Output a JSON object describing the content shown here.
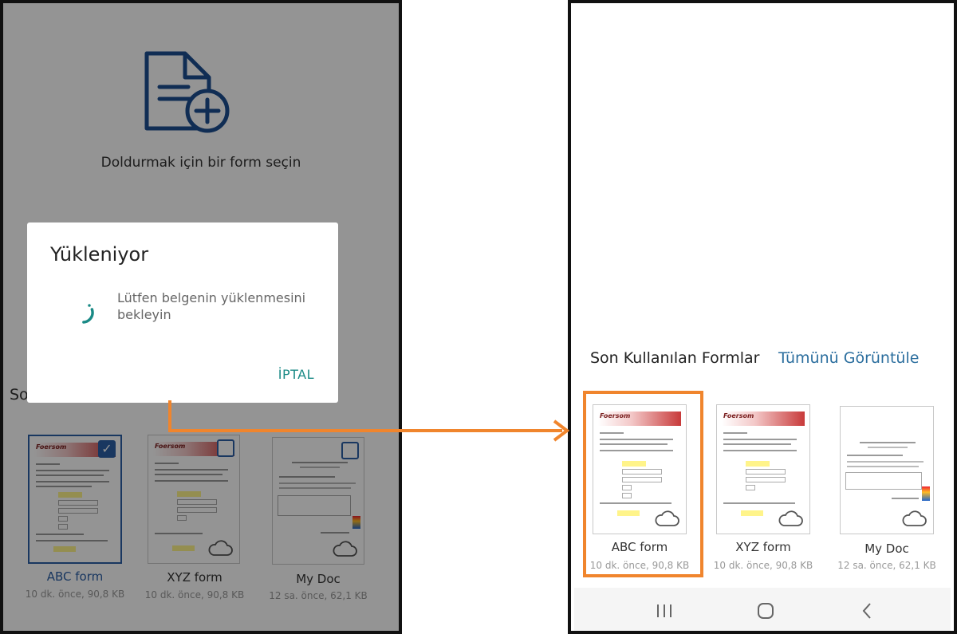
{
  "left_screen": {
    "prompt_text": "Doldurmak için bir form seçin",
    "recent_partial": "So",
    "dialog": {
      "title": "Yükleniyor",
      "message": "Lütfen belgenin yüklenmesini bekleyin",
      "cancel_label": "İPTAL"
    },
    "forms": [
      {
        "name": "ABC form",
        "meta": "10 dk. önce, 90,8 KB",
        "checked": true,
        "logo": "Foersom"
      },
      {
        "name": "XYZ form",
        "meta": "10 dk. önce, 90,8 KB",
        "checked": false,
        "logo": "Foersom"
      },
      {
        "name": "My Doc",
        "meta": "12 sa. önce, 62,1 KB",
        "checked": false
      }
    ]
  },
  "right_screen": {
    "section_title": "Son Kullanılan Formlar",
    "view_all_label": "Tümünü Görüntüle",
    "forms": [
      {
        "name": "ABC form",
        "meta": "10 dk. önce, 90,8 KB",
        "logo": "Foersom"
      },
      {
        "name": "XYZ form",
        "meta": "10 dk. önce, 90,8 KB",
        "logo": "Foersom"
      },
      {
        "name": "My Doc",
        "meta": "12 sa. önce, 62,1 KB"
      }
    ]
  },
  "icons": {
    "add_file": "file-add-icon",
    "spinner": "loading-spinner-icon",
    "cloud": "cloud-icon",
    "checkbox": "checkbox-icon",
    "nav_recents": "recents-icon",
    "nav_home": "home-icon",
    "nav_back": "back-icon"
  },
  "colors": {
    "accent_teal": "#1a8a86",
    "link_blue": "#2b6e9e",
    "selection_blue": "#2c5fa6",
    "callout_orange": "#f0852d"
  }
}
